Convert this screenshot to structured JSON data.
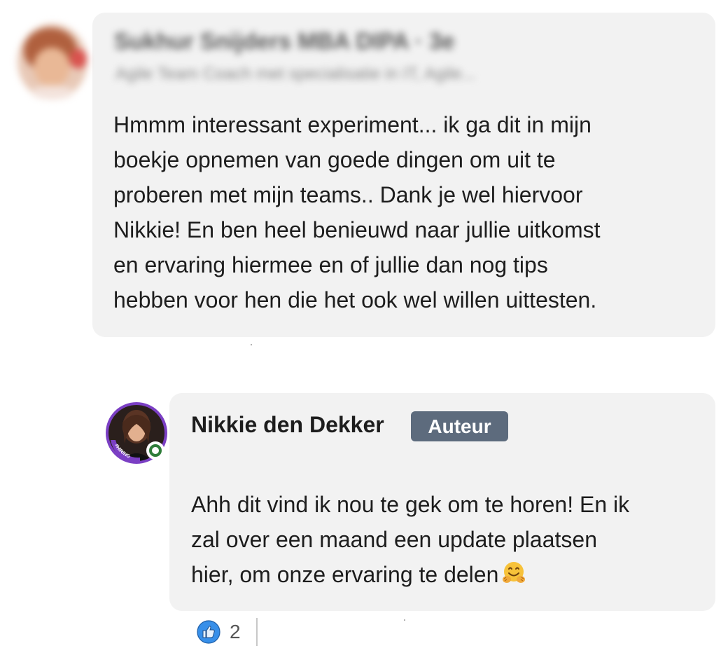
{
  "first_comment": {
    "author_name": "Sukhur Snijders MBA DIPA · 3e",
    "author_headline": "Agile Team Coach met specialisatie in IT, Agile...",
    "text_lines": [
      "Hmmm interessant experiment... ik ga dit in mijn",
      "boekje opnemen van goede dingen om uit te",
      "proberen met mijn teams.. Dank je wel hiervoor",
      "Nikkie! En ben heel benieuwd naar jullie uitkomst",
      "en ervaring hiermee en of jullie dan nog tips",
      "hebben voor hen die het ook wel willen uittesten."
    ]
  },
  "reply": {
    "author_name": "Nikkie den Dekker",
    "badge": "Auteur",
    "avatar_ring_text": "#HIRING",
    "text_lines": [
      "Ahh dit vind ik nou te gek om te horen! En ik",
      "zal over een maand een update plaatsen",
      "hier, om onze ervaring te delen"
    ],
    "emoji": "hugging-face-icon",
    "reactions": {
      "icon": "like-icon",
      "count": "2"
    }
  },
  "colors": {
    "bubble": "#f2f2f2",
    "badge": "#5d6b7d",
    "online": "#2f7d3a",
    "hiring_ring": "#7b3fc4",
    "like": "#378fe9"
  }
}
